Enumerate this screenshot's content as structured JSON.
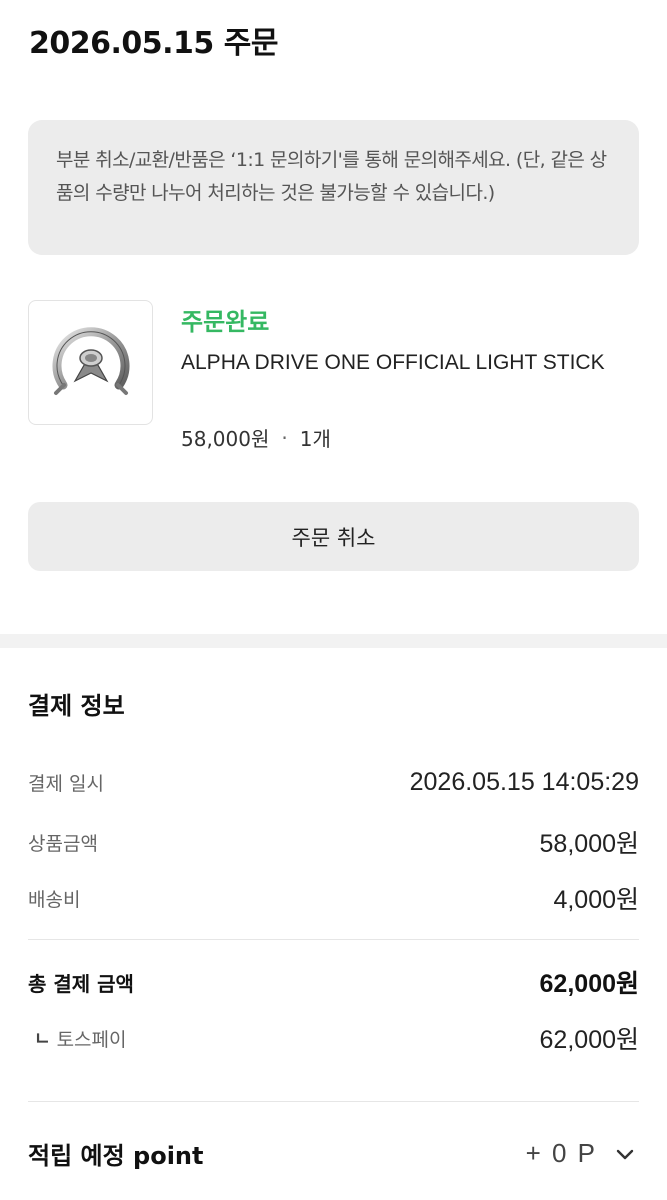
{
  "header": {
    "title": "2026.05.15 주문"
  },
  "notice": {
    "text": "부분 취소/교환/반품은 ‘1:1 문의하기'를 통해 문의해주세요. (단, 같은 상품의 수량만 나누어 처리하는 것은 불가능할 수 있습니다.)"
  },
  "product": {
    "status": "주문완료",
    "status_color": "#35b862",
    "name": "ALPHA DRIVE ONE OFFICIAL LIGHT STICK",
    "price": "58,000원",
    "separator": "·",
    "quantity": "1개",
    "thumbnail_icon": "lightstick-image"
  },
  "actions": {
    "cancel_label": "주문 취소"
  },
  "payment": {
    "title": "결제 정보",
    "rows": [
      {
        "label": "결제 일시",
        "value": "2026.05.15 14:05:29"
      },
      {
        "label": "상품금액",
        "value": "58,000원"
      },
      {
        "label": "배송비",
        "value": "4,000원"
      }
    ],
    "total": {
      "label": "총 결제 금액",
      "value": "62,000원"
    },
    "method": {
      "marker": "ㄴ",
      "label": "토스페이",
      "value": "62,000원"
    }
  },
  "points": {
    "label": "적립 예정 point",
    "value": "+ 0 P",
    "toggle_icon": "chevron-down-icon"
  }
}
